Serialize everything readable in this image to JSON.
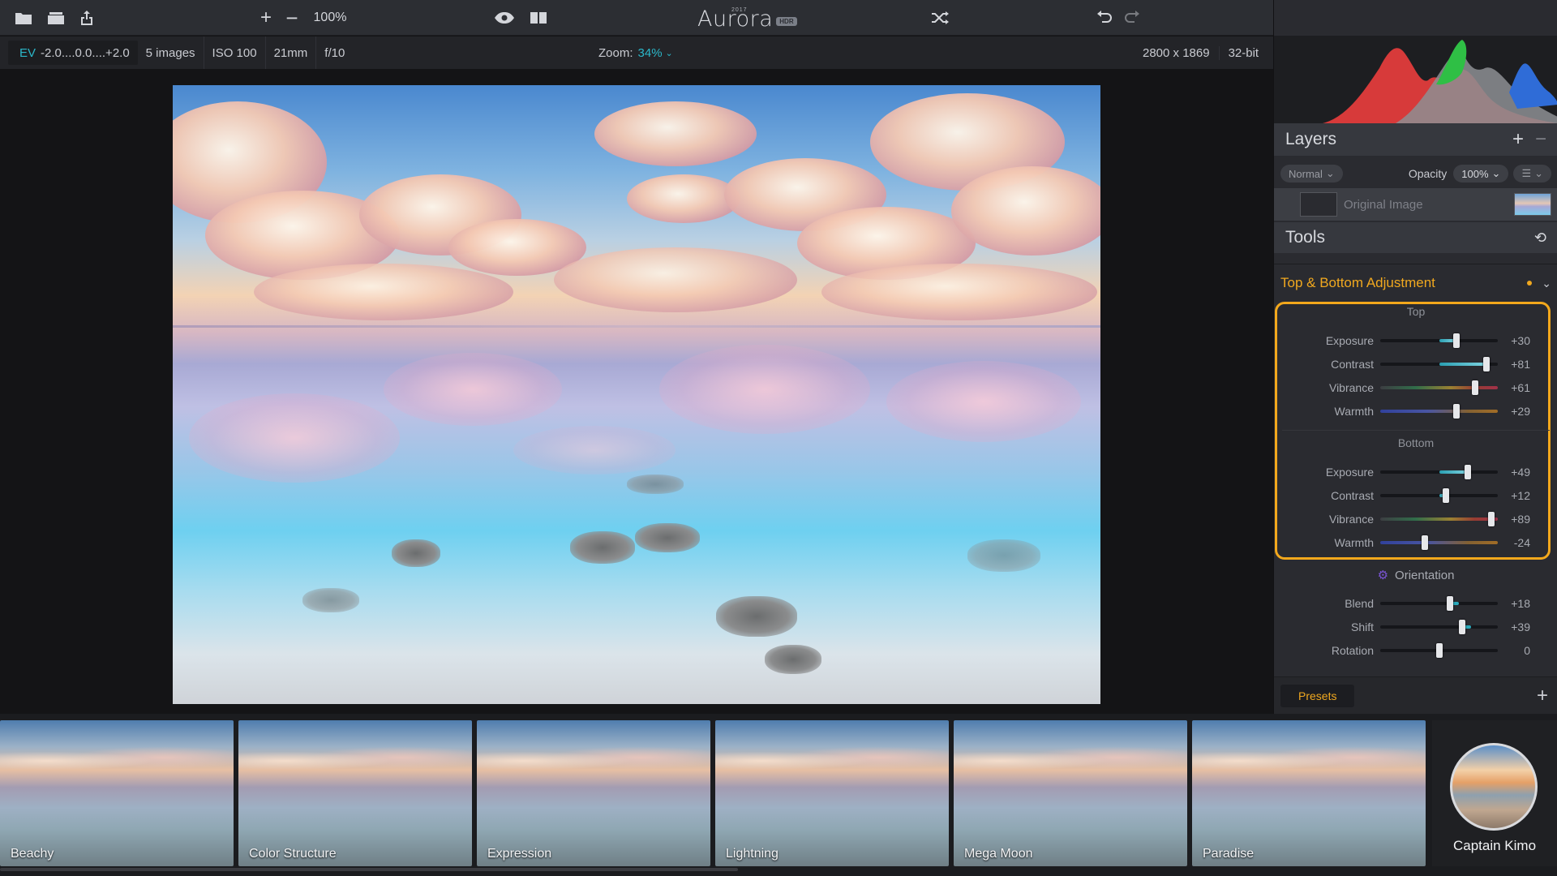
{
  "app": {
    "logo_text": "Aurora",
    "logo_year": "2017",
    "logo_badge": "HDR"
  },
  "toolbar": {
    "zoom_percent": "100%",
    "icons": [
      "folder-icon",
      "layers-stack-icon",
      "share-icon",
      "zoom-in-icon",
      "zoom-out-icon",
      "eye-icon",
      "split-view-icon",
      "shuffle-icon",
      "undo-icon",
      "redo-icon",
      "hand-tool-icon",
      "brush-tool-icon",
      "panel-layout-icon",
      "layers-icon",
      "image-icon"
    ]
  },
  "infobar": {
    "ev_label": "EV",
    "ev_values": "-2.0....0.0....+2.0",
    "images": "5 images",
    "iso": "ISO 100",
    "focal": "21mm",
    "aperture": "f/10",
    "zoom_label": "Zoom:",
    "zoom_value": "34%",
    "dimensions": "2800 x 1869",
    "bit_depth": "32-bit"
  },
  "layers": {
    "title": "Layers",
    "blend_mode": "Normal",
    "opacity_label": "Opacity",
    "opacity_value": "100%",
    "layer_name": "Original Image"
  },
  "tools": {
    "title": "Tools"
  },
  "adjustment": {
    "title": "Top & Bottom Adjustment",
    "top_label": "Top",
    "bottom_label": "Bottom",
    "orientation_label": "Orientation",
    "top": [
      {
        "label": "Exposure",
        "value": "+30",
        "level": 30
      },
      {
        "label": "Contrast",
        "value": "+81",
        "level": 81
      },
      {
        "label": "Vibrance",
        "value": "+61",
        "level": 61
      },
      {
        "label": "Warmth",
        "value": "+29",
        "level": 29
      }
    ],
    "bottom": [
      {
        "label": "Exposure",
        "value": "+49",
        "level": 49
      },
      {
        "label": "Contrast",
        "value": "+12",
        "level": 12
      },
      {
        "label": "Vibrance",
        "value": "+89",
        "level": 89
      },
      {
        "label": "Warmth",
        "value": "-24",
        "level": -24
      }
    ],
    "orientation": [
      {
        "label": "Blend",
        "value": "+18",
        "level": 18
      },
      {
        "label": "Shift",
        "value": "+39",
        "level": 39
      },
      {
        "label": "Rotation",
        "value": "0",
        "level": 0
      }
    ]
  },
  "presets": {
    "tab_label": "Presets",
    "items": [
      "Beachy",
      "Color Structure",
      "Expression",
      "Lightning",
      "Mega Moon",
      "Paradise"
    ],
    "active": "Captain Kimo"
  },
  "colors": {
    "accent_orange": "#f3a81c",
    "accent_teal": "#2bb7c9"
  }
}
